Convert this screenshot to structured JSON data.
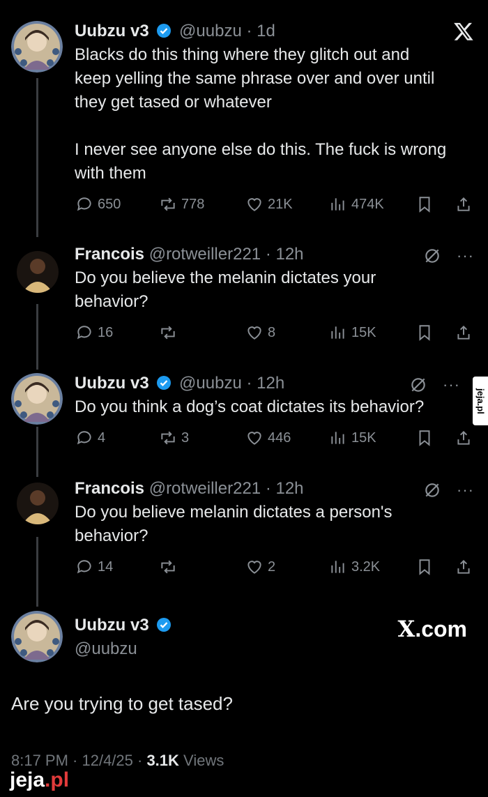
{
  "tweets": [
    {
      "name": "Uubzu v3",
      "handle": "@uubzu",
      "time": "· 1d",
      "lines": [
        "Blacks do this thing where they glitch out and",
        "keep yelling the same phrase over and over until",
        "they get tased or whatever",
        "",
        "I never see anyone else do this. The fuck is wrong",
        "with them"
      ],
      "stats": {
        "replies": "650",
        "reposts": "778",
        "likes": "21K",
        "views": "474K"
      }
    },
    {
      "name": "Francois",
      "handle": "@rotweiller221",
      "time": "· 12h",
      "lines": [
        "Do you believe the melanin dictates your",
        "behavior?"
      ],
      "stats": {
        "replies": "16",
        "reposts": "",
        "likes": "8",
        "views": "15K"
      }
    },
    {
      "name": "Uubzu v3",
      "handle": "@uubzu",
      "time": "· 12h",
      "lines": [
        "Do you think a dog’s coat dictates its behavior?"
      ],
      "stats": {
        "replies": "4",
        "reposts": "3",
        "likes": "446",
        "views": "15K"
      }
    },
    {
      "name": "Francois",
      "handle": "@rotweiller221",
      "time": "· 12h",
      "lines": [
        "Do you believe melanin dictates a person's",
        "behavior?"
      ],
      "stats": {
        "replies": "14",
        "reposts": "",
        "likes": "2",
        "views": "3.2K"
      }
    }
  ],
  "main": {
    "name": "Uubzu v3",
    "handle": "@uubzu",
    "text": "Are you trying to get tased?",
    "time": "8:17 PM · 12/4/25 · ",
    "views_count": "3.1K",
    "views_label": "Views"
  },
  "branding": {
    "xcom": ".com",
    "xcom_mark": "X",
    "watermark": "jeja",
    "watermark_tld": ".pl",
    "side_watermark": "jeja.pl"
  },
  "colors": {
    "background": "#000000",
    "verified": "#1d9bf0",
    "muted": "#8b9096"
  }
}
